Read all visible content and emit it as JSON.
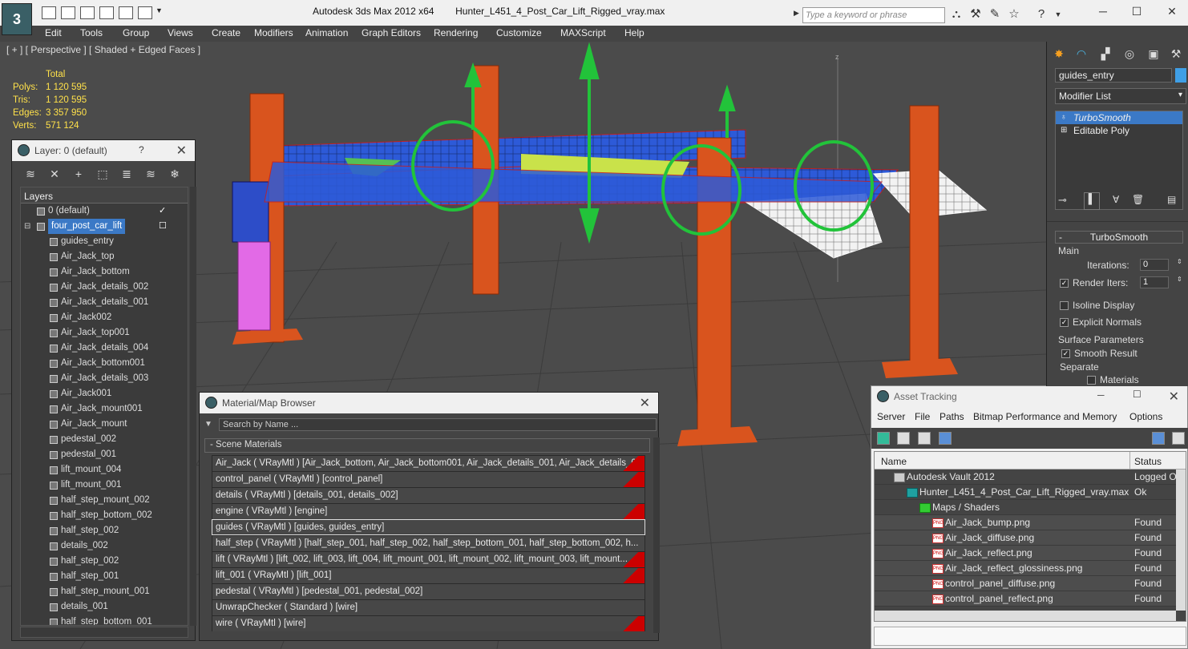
{
  "titlebar": {
    "app": "Autodesk 3ds Max  2012 x64",
    "file": "Hunter_L451_4_Post_Car_Lift_Rigged_vray.max",
    "search_placeholder": "Type a keyword or phrase"
  },
  "menu": [
    "Edit",
    "Tools",
    "Group",
    "Views",
    "Create",
    "Modifiers",
    "Animation",
    "Graph Editors",
    "Rendering",
    "Customize",
    "MAXScript",
    "Help"
  ],
  "viewport": {
    "label": "[ + ] [ Perspective ] [ Shaded + Edged Faces ]",
    "stats_header": "Total",
    "stats": [
      {
        "label": "Polys:",
        "value": "1 120 595"
      },
      {
        "label": "Tris:",
        "value": "1 120 595"
      },
      {
        "label": "Edges:",
        "value": "3 357 950"
      },
      {
        "label": "Verts:",
        "value": "571 124"
      }
    ],
    "axis_label": "z"
  },
  "layer_panel": {
    "title": "Layer: 0 (default)",
    "help": "?",
    "header": "Layers",
    "items": [
      {
        "name": "0 (default)",
        "indent": 0
      },
      {
        "name": "four_post_car_lift",
        "indent": 0,
        "selected": true
      },
      {
        "name": "guides_entry",
        "indent": 1
      },
      {
        "name": "Air_Jack_top",
        "indent": 1
      },
      {
        "name": "Air_Jack_bottom",
        "indent": 1
      },
      {
        "name": "Air_Jack_details_002",
        "indent": 1
      },
      {
        "name": "Air_Jack_details_001",
        "indent": 1
      },
      {
        "name": "Air_Jack002",
        "indent": 1
      },
      {
        "name": "Air_Jack_top001",
        "indent": 1
      },
      {
        "name": "Air_Jack_details_004",
        "indent": 1
      },
      {
        "name": "Air_Jack_bottom001",
        "indent": 1
      },
      {
        "name": "Air_Jack_details_003",
        "indent": 1
      },
      {
        "name": "Air_Jack001",
        "indent": 1
      },
      {
        "name": "Air_Jack_mount001",
        "indent": 1
      },
      {
        "name": "Air_Jack_mount",
        "indent": 1
      },
      {
        "name": "pedestal_002",
        "indent": 1
      },
      {
        "name": "pedestal_001",
        "indent": 1
      },
      {
        "name": "lift_mount_004",
        "indent": 1
      },
      {
        "name": "lift_mount_001",
        "indent": 1
      },
      {
        "name": "half_step_mount_002",
        "indent": 1
      },
      {
        "name": "half_step_bottom_002",
        "indent": 1
      },
      {
        "name": "half_step_002",
        "indent": 1
      },
      {
        "name": "details_002",
        "indent": 1
      },
      {
        "name": "half_step_002",
        "indent": 1
      },
      {
        "name": "half_step_001",
        "indent": 1
      },
      {
        "name": "half_step_mount_001",
        "indent": 1
      },
      {
        "name": "details_001",
        "indent": 1
      },
      {
        "name": "half_step_bottom_001",
        "indent": 1
      }
    ]
  },
  "material_browser": {
    "title": "Material/Map Browser",
    "search_placeholder": "Search by Name ...",
    "section": "- Scene Materials",
    "rows": [
      {
        "text": "Air_Jack  ( VRayMtl )  [Air_Jack_bottom, Air_Jack_bottom001, Air_Jack_details_001, Air_Jack_details_00...",
        "red": true
      },
      {
        "text": "control_panel  ( VRayMtl )  [control_panel]",
        "red": true
      },
      {
        "text": "details  ( VRayMtl )  [details_001, details_002]",
        "red": false
      },
      {
        "text": "engine  ( VRayMtl )  [engine]",
        "red": true
      },
      {
        "text": "guides  ( VRayMtl )  [guides, guides_entry]",
        "red": false,
        "highlight": true
      },
      {
        "text": "half_step  ( VRayMtl )  [half_step_001, half_step_002, half_step_bottom_001, half_step_bottom_002, h...",
        "red": false
      },
      {
        "text": "lift  ( VRayMtl )  [lift_002, lift_003, lift_004, lift_mount_001, lift_mount_002, lift_mount_003, lift_mount...",
        "red": true
      },
      {
        "text": "lift_001  ( VRayMtl )  [lift_001]",
        "red": true
      },
      {
        "text": "pedestal  ( VRayMtl )  [pedestal_001, pedestal_002]",
        "red": false
      },
      {
        "text": "UnwrapChecker  ( Standard )  [wire]",
        "red": false
      },
      {
        "text": "wire  ( VRayMtl )  [wire]",
        "red": true
      }
    ]
  },
  "asset_tracking": {
    "title": "Asset Tracking",
    "menu": [
      "Server",
      "File",
      "Paths",
      "Bitmap Performance and Memory",
      "Options"
    ],
    "col_name": "Name",
    "col_status": "Status",
    "rows": [
      {
        "name": "Autodesk Vault 2012",
        "status": "Logged O",
        "indent": 40,
        "type": "vault"
      },
      {
        "name": "Hunter_L451_4_Post_Car_Lift_Rigged_vray.max",
        "status": "Ok",
        "indent": 56,
        "type": "max"
      },
      {
        "name": "Maps / Shaders",
        "status": "",
        "indent": 72,
        "type": "folder"
      },
      {
        "name": "Air_Jack_bump.png",
        "status": "Found",
        "indent": 88,
        "type": "png"
      },
      {
        "name": "Air_Jack_diffuse.png",
        "status": "Found",
        "indent": 88,
        "type": "png"
      },
      {
        "name": "Air_Jack_reflect.png",
        "status": "Found",
        "indent": 88,
        "type": "png"
      },
      {
        "name": "Air_Jack_reflect_glossiness.png",
        "status": "Found",
        "indent": 88,
        "type": "png"
      },
      {
        "name": "control_panel_diffuse.png",
        "status": "Found",
        "indent": 88,
        "type": "png"
      },
      {
        "name": "control_panel_reflect.png",
        "status": "Found",
        "indent": 88,
        "type": "png"
      }
    ]
  },
  "command_panel": {
    "object_name": "guides_entry",
    "modifier_list": "Modifier List",
    "stack": [
      {
        "name": "TurboSmooth",
        "selected": true
      },
      {
        "name": "Editable Poly",
        "selected": false
      }
    ],
    "rollout_title": "TurboSmooth",
    "main_group": "Main",
    "iterations_label": "Iterations:",
    "iterations_value": "0",
    "render_iters_label": "Render Iters:",
    "render_iters_value": "1",
    "isoline_label": "Isoline Display",
    "explicit_normals_label": "Explicit Normals",
    "surface_group": "Surface Parameters",
    "smooth_result_label": "Smooth Result",
    "separate_label": "Separate",
    "materials_label": "Materials"
  },
  "colors": {
    "selection": "#3b79c6",
    "wire_orange": "#d9541e",
    "wire_blue": "#2d5ad8",
    "gizmo_green": "#22c33a"
  }
}
